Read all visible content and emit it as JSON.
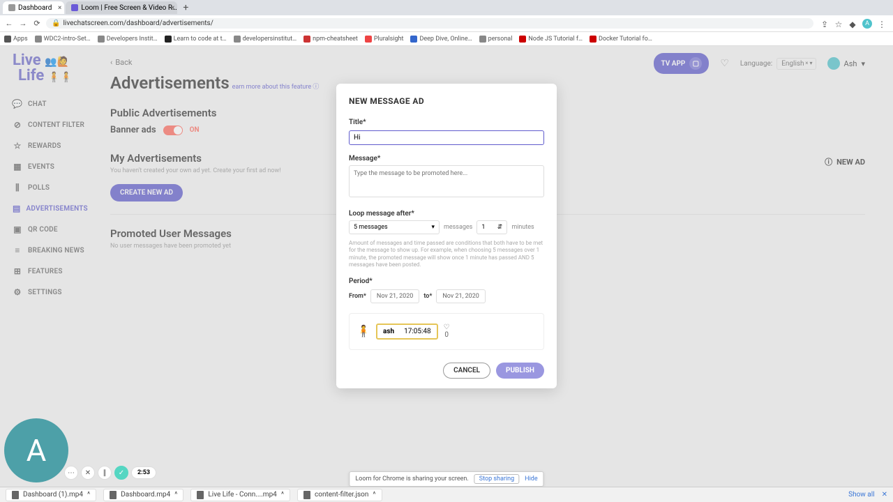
{
  "browser": {
    "tabs": [
      {
        "title": "Dashboard"
      },
      {
        "title": "Loom | Free Screen & Video R…"
      }
    ],
    "url": "livechatscreen.com/dashboard/advertisements/",
    "bookmarks": [
      "Apps",
      "WDC2-intro-Set…",
      "Developers Instit…",
      "Learn to code at t…",
      "developersinstitut…",
      "npm-cheatsheet",
      "Pluralsight",
      "Deep Dive, Online…",
      "personal",
      "Node JS Tutorial f…",
      "Docker Tutorial fo…"
    ]
  },
  "sidebar": {
    "items": [
      {
        "icon": "💬",
        "label": "CHAT"
      },
      {
        "icon": "⊘",
        "label": "CONTENT FILTER"
      },
      {
        "icon": "☆",
        "label": "REWARDS"
      },
      {
        "icon": "▦",
        "label": "EVENTS"
      },
      {
        "icon": "⫼",
        "label": "POLLS"
      },
      {
        "icon": "▤",
        "label": "ADVERTISEMENTS"
      },
      {
        "icon": "▣",
        "label": "QR CODE"
      },
      {
        "icon": "≡",
        "label": "BREAKING NEWS"
      },
      {
        "icon": "⊞",
        "label": "FEATURES"
      },
      {
        "icon": "⚙",
        "label": "SETTINGS"
      }
    ],
    "active_index": 5
  },
  "header": {
    "back": "Back",
    "tv_app": "TV APP",
    "language_label": "Language:",
    "language_value": "English",
    "user": "Ash"
  },
  "page": {
    "title": "Advertisements",
    "learn_more": "earn more about this feature ⓘ",
    "public_h": "Public Advertisements",
    "banner_label": "Banner ads",
    "banner_state": "ON",
    "my_ads_h": "My Advertisements",
    "my_ads_sub": "You haven't created your own ad yet. Create your first ad now!",
    "create_btn": "CREATE NEW AD",
    "promoted_h": "Promoted User Messages",
    "promoted_sub": "No user messages have been promoted yet",
    "new_ad_link": "NEW AD"
  },
  "modal": {
    "title": "NEW MESSAGE AD",
    "title_label": "Title*",
    "title_value": "Hi",
    "message_label": "Message*",
    "message_placeholder": "Type the message to be promoted here...",
    "loop_label": "Loop message after*",
    "loop_select": "5 messages",
    "loop_after_word": "messages",
    "minutes_value": "1",
    "minutes_word": "minutes",
    "hint": "Amount of messages and time passed are conditions that both have to be met for the message to show up. For example, when choosing 5 messages over 1 minute, the promoted message will show once 1 minute has passed AND 5 messages have been posted.",
    "period_label": "Period*",
    "from_label": "From*",
    "from_value": "Nov 21, 2020",
    "to_label": "to*",
    "to_value": "Nov 21, 2020",
    "preview": {
      "user": "ash",
      "time": "17:05:48",
      "likes": "0"
    },
    "cancel": "CANCEL",
    "publish": "PUBLISH"
  },
  "loom": {
    "letter": "A",
    "timer": "2:53"
  },
  "downloads": [
    "Dashboard (1).mp4",
    "Dashboard.mp4",
    "Live Life - Conn....mp4",
    "content-filter.json"
  ],
  "share": {
    "text": "Loom for Chrome is sharing your screen.",
    "stop": "Stop sharing",
    "hide": "Hide"
  },
  "showall": "Show all"
}
